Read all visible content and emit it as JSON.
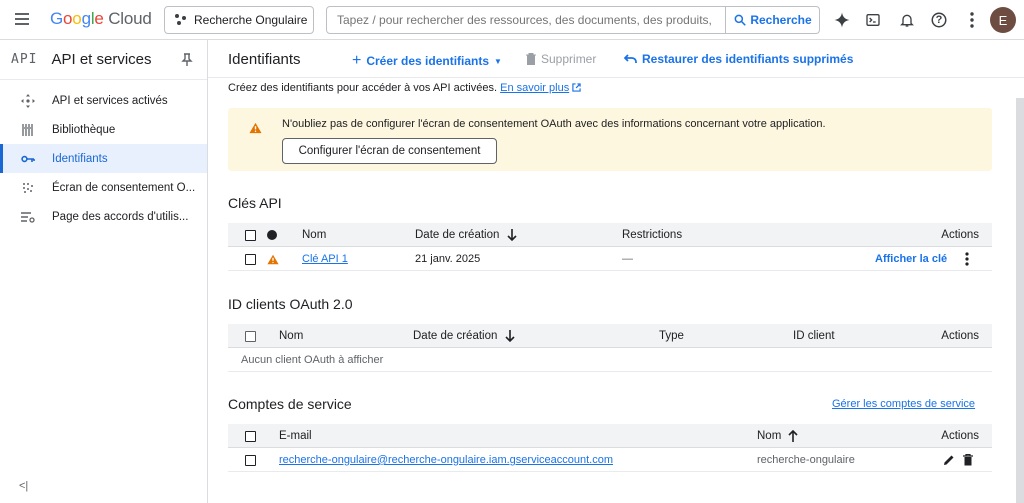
{
  "topbar": {
    "logo_google": [
      "G",
      "o",
      "o",
      "g",
      "l",
      "e"
    ],
    "logo_cloud": "Cloud",
    "project_label": "Recherche Ongulaire",
    "search_placeholder": "Tapez / pour rechercher des ressources, des documents, des produits, etc",
    "search_button": "Recherche",
    "avatar_letter": "E",
    "help": "?"
  },
  "sidebar": {
    "badge": "API",
    "title": "API et services",
    "items": [
      {
        "label": "API et services activés",
        "icon": "api-hub-icon"
      },
      {
        "label": "Bibliothèque",
        "icon": "library-icon"
      },
      {
        "label": "Identifiants",
        "icon": "key-icon",
        "active": true
      },
      {
        "label": "Écran de consentement O...",
        "icon": "consent-icon"
      },
      {
        "label": "Page des accords d'utilis...",
        "icon": "settings-list-icon"
      }
    ],
    "collapse": "<|"
  },
  "header": {
    "title": "Identifiants",
    "create": "Créer des identifiants",
    "delete": "Supprimer",
    "restore": "Restaurer des identifiants supprimés"
  },
  "intro": {
    "text": "Créez des identifiants pour accéder à vos API activées.",
    "link": "En savoir plus"
  },
  "warning": {
    "text": "N'oubliez pas de configurer l'écran de consentement OAuth avec des informations concernant votre application.",
    "button": "Configurer l'écran de consentement"
  },
  "api_keys": {
    "title": "Clés API",
    "columns": {
      "name": "Nom",
      "date": "Date de création",
      "restrictions": "Restrictions",
      "actions": "Actions"
    },
    "rows": [
      {
        "name": "Clé API 1",
        "date": "21 janv. 2025",
        "restrictions": "—",
        "action": "Afficher la clé"
      }
    ]
  },
  "oauth": {
    "title": "ID clients OAuth 2.0",
    "columns": {
      "name": "Nom",
      "date": "Date de création",
      "type": "Type",
      "client_id": "ID client",
      "actions": "Actions"
    },
    "empty": "Aucun client OAuth à afficher"
  },
  "service_accounts": {
    "title": "Comptes de service",
    "manage_link": "Gérer les comptes de service",
    "columns": {
      "email": "E-mail",
      "name": "Nom",
      "actions": "Actions"
    },
    "rows": [
      {
        "email": "recherche-ongulaire@recherche-ongulaire.iam.gserviceaccount.com",
        "name": "recherche-ongulaire"
      }
    ]
  },
  "colors": {
    "accent": "#1a73e8",
    "warning": "#e37400",
    "warn_bg": "#fef7e0"
  }
}
